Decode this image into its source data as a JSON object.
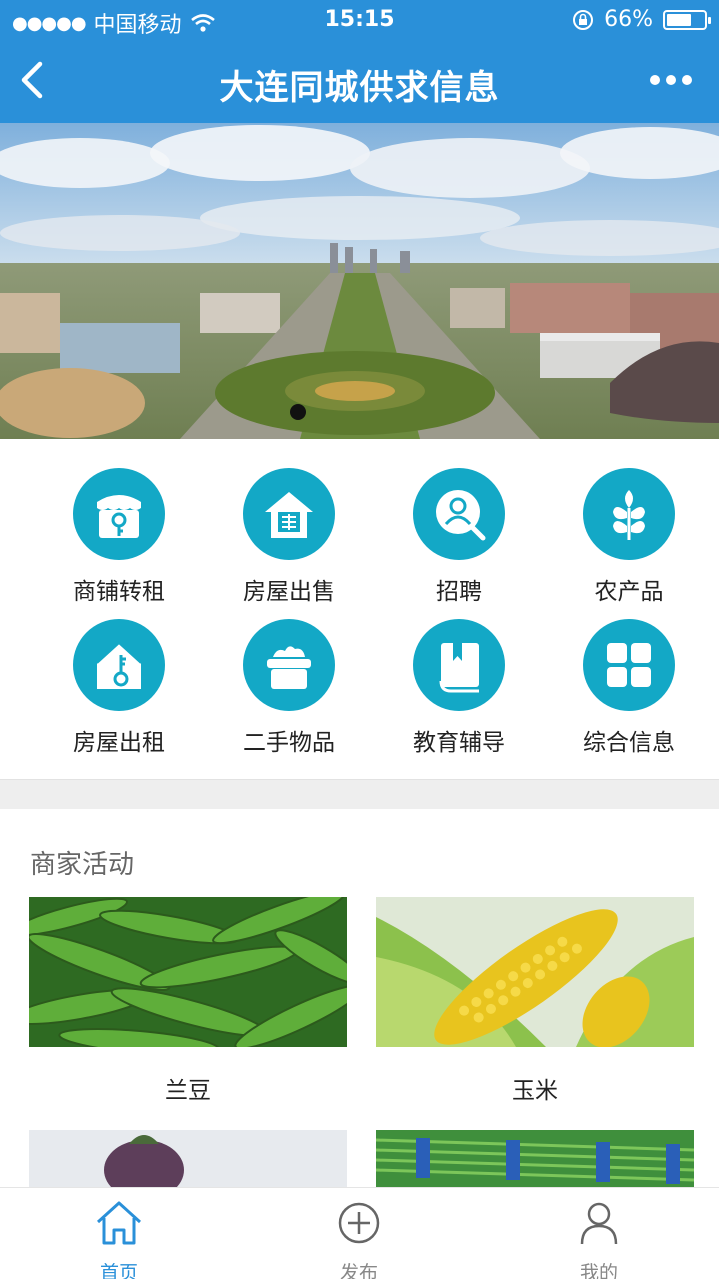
{
  "status_bar": {
    "carrier": "中国移动",
    "time": "15:15",
    "battery": "66%",
    "battery_level": 0.66
  },
  "nav": {
    "title": "大连同城供求信息"
  },
  "banner": {
    "active_slide": 0
  },
  "categories": [
    {
      "label": "商铺转租",
      "icon": "shop-icon"
    },
    {
      "label": "房屋出售",
      "icon": "house-sale-icon"
    },
    {
      "label": "招聘",
      "icon": "person-icon"
    },
    {
      "label": "农产品",
      "icon": "wheat-icon"
    },
    {
      "label": "房屋出租",
      "icon": "house-key-icon"
    },
    {
      "label": "二手物品",
      "icon": "basket-icon"
    },
    {
      "label": "教育辅导",
      "icon": "book-icon"
    },
    {
      "label": "综合信息",
      "icon": "grid-icon"
    }
  ],
  "merchant": {
    "title": "商家活动",
    "products": [
      {
        "name": "兰豆"
      },
      {
        "name": "玉米"
      }
    ]
  },
  "tabbar": {
    "items": [
      {
        "label": "首页",
        "icon": "home-icon",
        "active": true
      },
      {
        "label": "发布",
        "icon": "plus-circle-icon",
        "active": false
      },
      {
        "label": "我的",
        "icon": "user-icon",
        "active": false
      }
    ]
  },
  "colors": {
    "primary": "#2a90d9",
    "icon_circle": "#13a8c6",
    "active_tab": "#2a90d9",
    "inactive_tab": "#888888"
  }
}
